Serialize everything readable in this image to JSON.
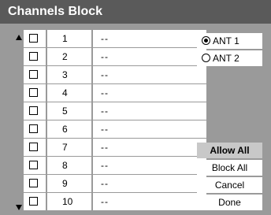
{
  "window": {
    "title": "Channels Block"
  },
  "channels": [
    {
      "number": "1",
      "name": "--",
      "checked": false
    },
    {
      "number": "2",
      "name": "--",
      "checked": false
    },
    {
      "number": "3",
      "name": "--",
      "checked": false
    },
    {
      "number": "4",
      "name": "--",
      "checked": false
    },
    {
      "number": "5",
      "name": "--",
      "checked": false
    },
    {
      "number": "6",
      "name": "--",
      "checked": false
    },
    {
      "number": "7",
      "name": "--",
      "checked": false
    },
    {
      "number": "8",
      "name": "--",
      "checked": false
    },
    {
      "number": "9",
      "name": "--",
      "checked": false
    },
    {
      "number": "10",
      "name": "--",
      "checked": false
    }
  ],
  "antenna": {
    "options": [
      {
        "label": "ANT 1",
        "selected": true
      },
      {
        "label": "ANT 2",
        "selected": false
      }
    ]
  },
  "buttons": {
    "allow_all": "Allow All",
    "block_all": "Block All",
    "cancel": "Cancel",
    "done": "Done"
  },
  "colors": {
    "panel": "#9a9a9a",
    "title_bar": "#5a5a5a",
    "highlight": "#c8c8c8"
  }
}
